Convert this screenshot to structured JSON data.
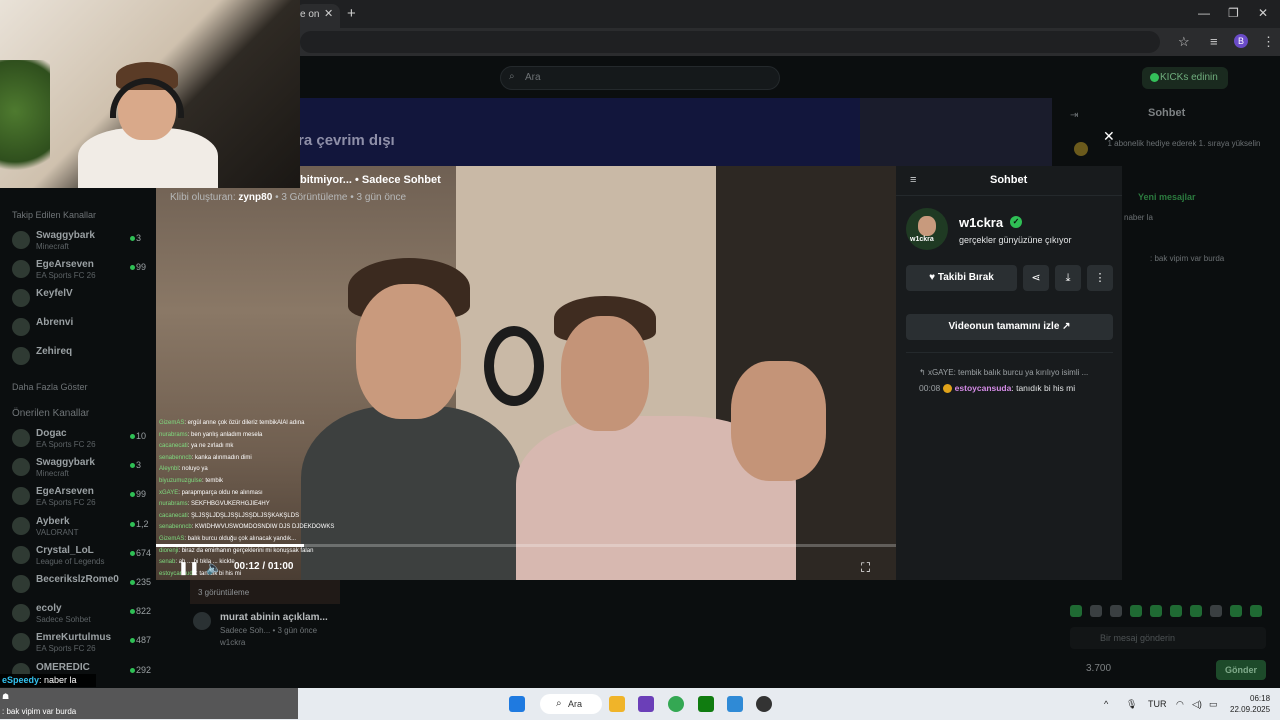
{
  "browser": {
    "tab_fragment": "e on",
    "close_glyph": "✕",
    "new_tab_glyph": "+",
    "minimize_glyph": "—",
    "restore_glyph": "❐",
    "close_window_glyph": "✕",
    "profile_initial": "B"
  },
  "header": {
    "search_placeholder": "Ara",
    "kicks_label": "KICKs edinin"
  },
  "banner": {
    "text": "ra çevrim dışı"
  },
  "sidebar": {
    "followed_title": "Takip Edilen Kanallar",
    "followed": [
      {
        "name": "Swaggybark",
        "category": "Minecraft",
        "count": "3"
      },
      {
        "name": "EgeArseven",
        "category": "EA Sports FC 26",
        "count": "99"
      },
      {
        "name": "KeyfelV",
        "category": "",
        "count": ""
      },
      {
        "name": "Abrenvi",
        "category": "",
        "count": ""
      },
      {
        "name": "Zehireq",
        "category": "",
        "count": ""
      }
    ],
    "show_more": "Daha Fazla Göster",
    "recommended_title": "Önerilen Kanallar",
    "recommended": [
      {
        "name": "Dogac",
        "category": "EA Sports FC 26",
        "count": "10"
      },
      {
        "name": "Swaggybark",
        "category": "Minecraft",
        "count": "3"
      },
      {
        "name": "EgeArseven",
        "category": "EA Sports FC 26",
        "count": "99"
      },
      {
        "name": "Ayberk",
        "category": "VALORANT",
        "count": "1,2"
      },
      {
        "name": "Crystal_LoL",
        "category": "League of Legends",
        "count": "674"
      },
      {
        "name": "BecerikslzRome0",
        "category": "",
        "count": "235"
      },
      {
        "name": "ecoly",
        "category": "Sadece Sohbet",
        "count": "822"
      },
      {
        "name": "EmreKurtulmus",
        "category": "EA Sports FC 26",
        "count": "487"
      },
      {
        "name": "OMEREDIC",
        "category": "",
        "count": "292"
      }
    ]
  },
  "clip": {
    "title": "bitmiyor... • Sadece Sohbet",
    "meta_prefix": "Klibi oluşturan:",
    "creator": "zynp80",
    "meta_rest": "• 3 Görüntüleme • 3 gün önce",
    "time": "00:12 / 01:00",
    "progress": 0.2,
    "close_glyph": "✕",
    "video_chat": [
      {
        "user": "GizemAS",
        "text": ": ergül anne çok özür dileriz tembikAlAl adına"
      },
      {
        "user": "nurabrams",
        "text": ": ben yanlış anladım mesela"
      },
      {
        "user": "cacanecati",
        "text": ": ya ne zırladı mk"
      },
      {
        "user": "senabenncb",
        "text": ": kanka alınmadın dimi"
      },
      {
        "user": "Aleynbl",
        "text": ": noluyo ya"
      },
      {
        "user": "biyuzumuzgulse",
        "text": ": tembik"
      },
      {
        "user": "xGAYE",
        "text": ": parapmparça oldu ne alınması"
      },
      {
        "user": "nurabrams",
        "text": ": SEKFHBGVUKERHGJIE4HY"
      },
      {
        "user": "cacanecati",
        "text": ": ŞLJSŞLJDŞLJSŞLJSŞDLJSŞKAKŞLDS"
      },
      {
        "user": "senabenncb",
        "text": ": KWIDHWVUSWOMDOSNDIW DJS DJDEKDOWKS"
      },
      {
        "user": "GizemAS",
        "text": ": balık burcu olduğu çok alınacak yandık..."
      },
      {
        "user": "diorenji",
        "text": ": biraz da emirhanın gerçeklerini mi konuşsak falan"
      },
      {
        "user": "senab",
        "text": ": ah ... bi tıkla ... kickte"
      },
      {
        "user": "estoycansuda",
        "text": ": tanıdık bi his mi"
      }
    ]
  },
  "panel": {
    "title": "Sohbet",
    "username": "w1ckra",
    "avatar_text": "w1ckra",
    "subtitle": "gerçekler günyüzüne çıkıyor",
    "follow_label": "Takibi Bırak",
    "full_video_label": "Videonun tamamını izle",
    "reply_to": "xGAYE: tembik balık burcu ya kırılıyo isimli ...",
    "message": {
      "time": "00:08",
      "user": "estoycansuda",
      "text": ": tanıdık bi his mi"
    }
  },
  "right_chat": {
    "title": "Sohbet",
    "gift_text": "1 abonelik hediye ederek 1. sıraya yükselin",
    "new_messages": "Yeni mesajlar",
    "line1": "naber la",
    "line2": ": bak vipim var burda",
    "input_placeholder": "Bir mesaj gönderin",
    "kicks_count": "3.700",
    "send_label": "Gönder"
  },
  "clip_card": {
    "views": "3 görüntüleme",
    "title": "murat abinin açıklam...",
    "sub": "Sadece Soh... • 3 gün önce",
    "user": "w1ckra"
  },
  "overlay_chat": {
    "line1_user": "eSpeedy",
    "line1_text": ": naber la",
    "line2_user": "",
    "line3_user": "",
    "line3_text": ": bak vipim var burda"
  },
  "taskbar": {
    "search": "Ara",
    "language": "TUR",
    "time": "06:18",
    "date": "22.09.2025"
  }
}
